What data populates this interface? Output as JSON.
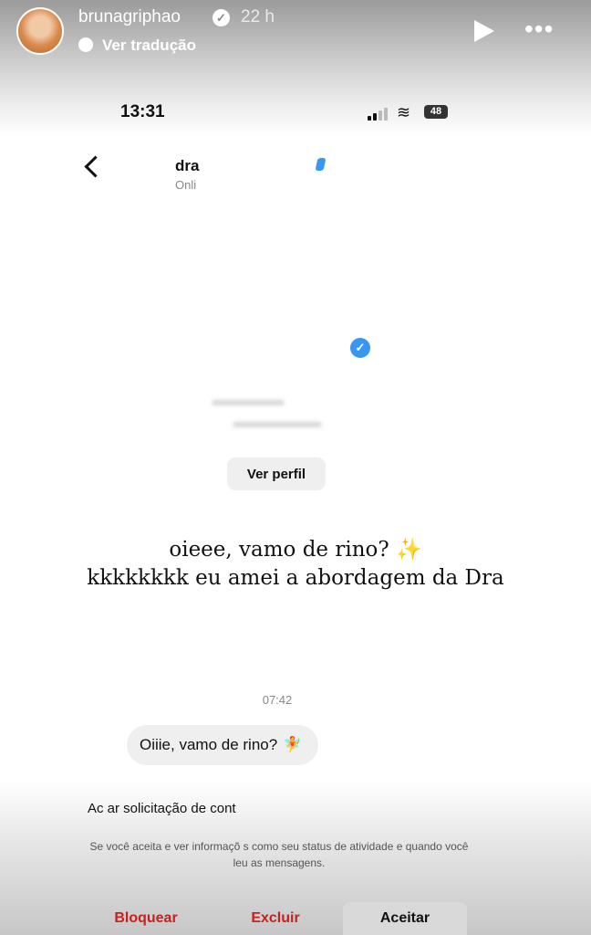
{
  "story": {
    "username": "brunagriphao",
    "time_ago": "22 h",
    "translate_label": "Ver tradução"
  },
  "phone": {
    "time": "13:31",
    "battery": "48"
  },
  "chat": {
    "name": "dra",
    "status": "Onli",
    "view_profile_label": "Ver perfil",
    "blurred_line_1": "— ————— —",
    "blurred_line_2": "——— ———"
  },
  "caption": {
    "line1": "oieee, vamo de rino?",
    "line1_emoji": "✨",
    "line2": "kkkkkkkk eu amei a abordagem da Dra"
  },
  "conversation": {
    "time": "07:42",
    "message": "Oiiie, vamo de rino?",
    "message_emoji": "🧚"
  },
  "request": {
    "title": "Ac   ar solicitação de cont",
    "info": "Se você aceita            e ver informaçõ s como seu status de atividade e quando você leu as mensagens.",
    "block_label": "Bloquear",
    "delete_label": "Excluir",
    "accept_label": "Aceitar"
  },
  "colors": {
    "verified_blue": "#3897f0",
    "danger_red": "#c5221f"
  }
}
